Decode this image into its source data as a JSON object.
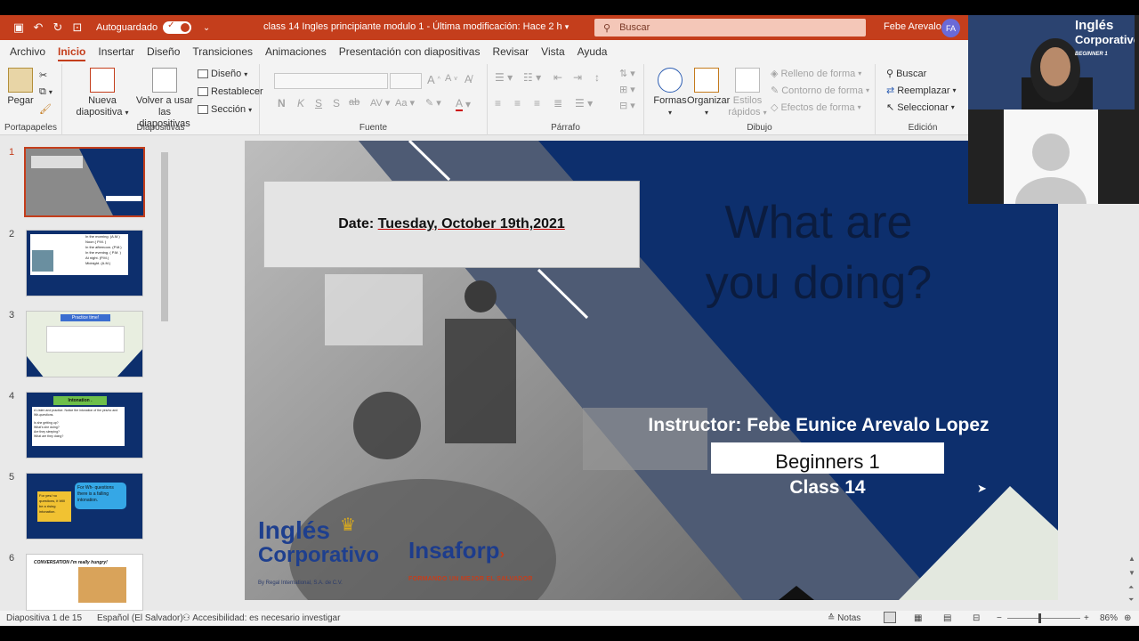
{
  "titlebar": {
    "autosave_label": "Autoguardado",
    "toggle_state": "Sí",
    "document_title": "class 14  Ingles principiante modulo 1  -  Última modificación: Hace 2 h",
    "search_placeholder": "Buscar",
    "user_name": "Febe Arevalo",
    "user_initials": "FA"
  },
  "menu": {
    "tabs": [
      "Archivo",
      "Inicio",
      "Insertar",
      "Diseño",
      "Transiciones",
      "Animaciones",
      "Presentación con diapositivas",
      "Revisar",
      "Vista",
      "Ayuda"
    ],
    "active": "Inicio"
  },
  "ribbon": {
    "portapapeles": {
      "paste": "Pegar",
      "label": "Portapapeles"
    },
    "diapositivas": {
      "new_slide_1": "Nueva",
      "new_slide_2": "diapositiva",
      "reuse_1": "Volver a usar",
      "reuse_2": "las diapositivas",
      "layout": "Diseño",
      "reset": "Restablecer",
      "section": "Sección",
      "label": "Diapositivas"
    },
    "fuente": {
      "bold": "N",
      "italic": "K",
      "underline": "S",
      "strike": "S",
      "strike2": "ab",
      "label": "Fuente"
    },
    "parrafo": {
      "label": "Párrafo"
    },
    "dibujo": {
      "shapes": "Formas",
      "arrange": "Organizar",
      "styles_1": "Estilos",
      "styles_2": "rápidos",
      "fill": "Relleno de forma",
      "outline": "Contorno de forma",
      "effects": "Efectos de forma",
      "label": "Dibujo"
    },
    "edicion": {
      "find": "Buscar",
      "replace": "Reemplazar",
      "select": "Seleccionar",
      "label": "Edición"
    }
  },
  "thumbnails": {
    "numbers": [
      "1",
      "2",
      "3",
      "4",
      "5",
      "6"
    ],
    "t2": {
      "lines": [
        "In the morning. (A.M.)",
        "Noon ( P.M. )",
        "In the afternoon. (P.M.)",
        "In the evening. ( P.M. )",
        "At night. (P.M.)",
        "Midnight. (A.M.)"
      ]
    },
    "t3": {
      "header": "Practice time!"
    },
    "t4": {
      "header": "Intonation .",
      "line1": "A  Listen and practice. Notice the intonation of the yes/no and Wh-questions.",
      "line2": "Is she getting up?",
      "line3": "What's she doing?",
      "line4": "Are they sleeping?",
      "line5": "What are they doing?"
    },
    "t5": {
      "left": "For yes/ no questions, it Will be a rising intonation.",
      "right": "For Wh- questions there is a falling intonation."
    },
    "t6": {
      "header": "CONVERSATION  I'm really hungry!"
    }
  },
  "slide": {
    "date_label": "Date:",
    "date_value": "Tuesday, October 19th,2021",
    "title_line1": "What are",
    "title_line2": "you doing?",
    "instructor": "Instructor: Febe Eunice Arevalo Lopez",
    "level": "Beginners 1",
    "class": "Class 14",
    "logo_ingles_1": "Inglés",
    "logo_ingles_2": "Corporativo",
    "logo_ingles_sub": "By Regal International, S.A. de C.V.",
    "logo_insaforp": "Insaforp",
    "logo_insaforp_sub": "FORMANDO UN MEJOR EL SALVADOR"
  },
  "video": {
    "logo_text_1": "Inglés",
    "logo_text_2": "Corporativo",
    "logo_sub": "BEGINNER 1"
  },
  "status": {
    "slide_count": "Diapositiva 1 de 15",
    "language": "Español (El Salvador)",
    "accessibility": "Accesibilidad: es necesario investigar",
    "notes": "Notas",
    "zoom": "86%"
  }
}
